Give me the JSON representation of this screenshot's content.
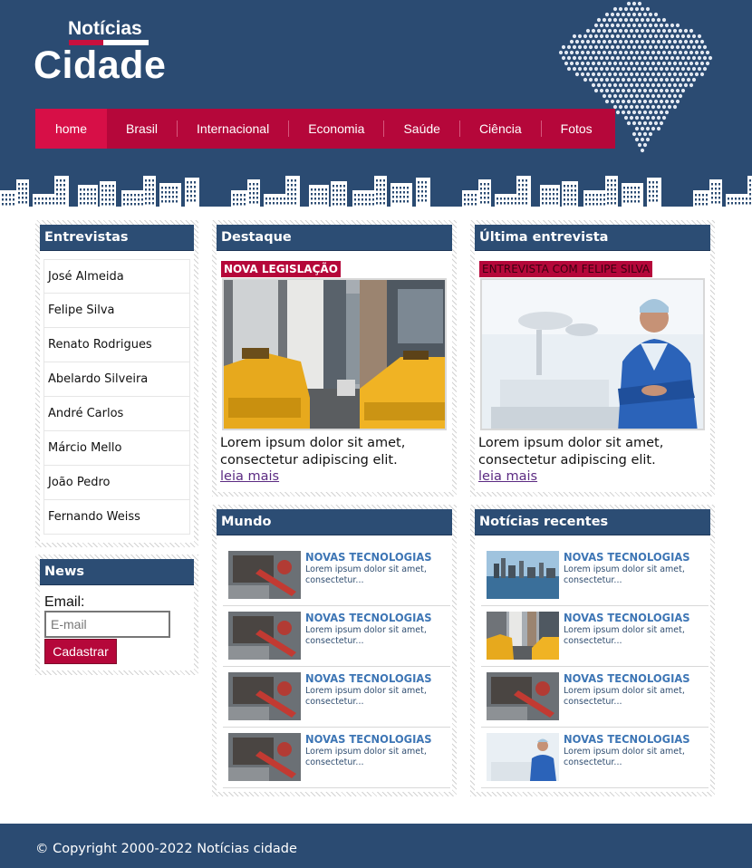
{
  "brand": {
    "small_title": "Notícias",
    "big_title": "Cidade",
    "colors": {
      "header_bg": "#2b4b72",
      "nav_bg": "#b5073a",
      "nav_active": "#d70f47",
      "accent_blue": "#3e76b5"
    }
  },
  "nav": {
    "items": [
      {
        "label": "home",
        "active": true
      },
      {
        "label": "Brasil"
      },
      {
        "label": "Internacional"
      },
      {
        "label": "Economia"
      },
      {
        "label": "Saúde"
      },
      {
        "label": "Ciência"
      },
      {
        "label": "Fotos"
      }
    ]
  },
  "entrevistas": {
    "title": "Entrevistas",
    "items": [
      "José Almeida",
      "Felipe Silva",
      "Renato Rodrigues",
      "Abelardo Silveira",
      "André Carlos",
      "Márcio Mello",
      "João Pedro",
      "Fernando Weiss"
    ]
  },
  "newsletter": {
    "title": "News",
    "email_label": "Email:",
    "email_placeholder": "E-mail",
    "submit_label": "Cadastrar"
  },
  "destaque": {
    "title": "Destaque",
    "tag": "NOVA LEGISLAÇÃO",
    "image": "city-taxis-photo",
    "text": "Lorem ipsum dolor sit amet, consectetur adipiscing elit.",
    "read_more": "leia mais"
  },
  "ultima_entrevista": {
    "title": "Última entrevista",
    "tag": "ENTREVISTA COM FELIPE SILVA",
    "image": "doctor-photo",
    "text": "Lorem ipsum dolor sit amet, consectetur adipiscing elit.",
    "read_more": "leia mais"
  },
  "mundo": {
    "title": "Mundo",
    "items": [
      {
        "headline": "NOVAS TECNOLOGIAS",
        "excerpt": "Lorem ipsum dolor sit amet, consectetur...",
        "thumb": "desk-photo"
      },
      {
        "headline": "NOVAS TECNOLOGIAS",
        "excerpt": "Lorem ipsum dolor sit amet, consectetur...",
        "thumb": "desk-photo"
      },
      {
        "headline": "NOVAS TECNOLOGIAS",
        "excerpt": "Lorem ipsum dolor sit amet, consectetur...",
        "thumb": "desk-photo"
      },
      {
        "headline": "NOVAS TECNOLOGIAS",
        "excerpt": "Lorem ipsum dolor sit amet, consectetur...",
        "thumb": "desk-photo"
      }
    ]
  },
  "recentes": {
    "title": "Notícias recentes",
    "items": [
      {
        "headline": "NOVAS TECNOLOGIAS",
        "excerpt": "Lorem ipsum dolor sit amet, consectetur...",
        "thumb": "skyline-photo"
      },
      {
        "headline": "NOVAS TECNOLOGIAS",
        "excerpt": "Lorem ipsum dolor sit amet, consectetur...",
        "thumb": "city-taxis-photo"
      },
      {
        "headline": "NOVAS TECNOLOGIAS",
        "excerpt": "Lorem ipsum dolor sit amet, consectetur...",
        "thumb": "desk-photo"
      },
      {
        "headline": "NOVAS TECNOLOGIAS",
        "excerpt": "Lorem ipsum dolor sit amet, consectetur...",
        "thumb": "doctor-photo"
      }
    ]
  },
  "footer": {
    "copyright": "© Copyright 2000-2022 Notícias cidade"
  }
}
